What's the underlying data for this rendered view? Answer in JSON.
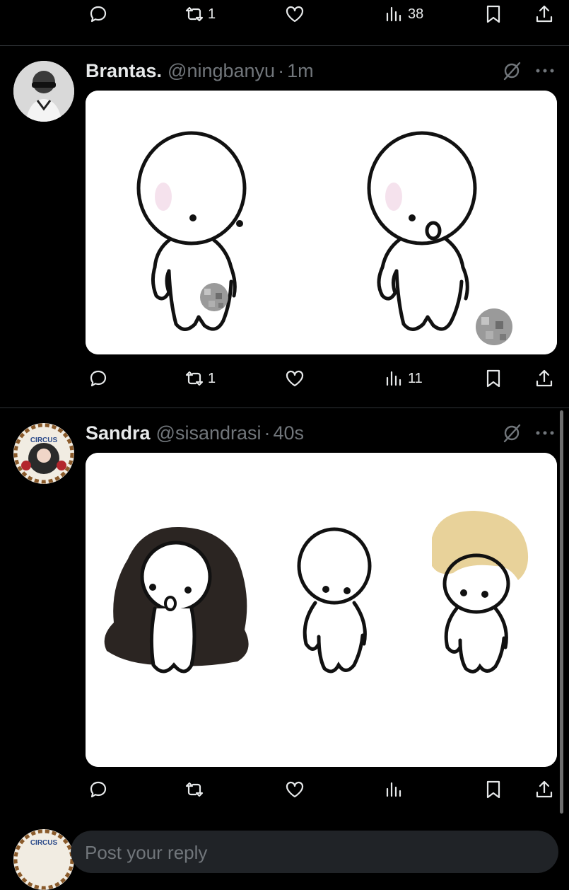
{
  "top_actions": {
    "retweets": "1",
    "views": "38"
  },
  "posts": [
    {
      "name": "Brantas.",
      "handle": "@ningbanyu",
      "sep": "·",
      "time": "1m",
      "stats": {
        "replies": "",
        "retweets": "1",
        "likes": "",
        "views": "11"
      }
    },
    {
      "name": "Sandra",
      "handle": "@sisandrasi",
      "sep": "·",
      "time": "40s",
      "avatar_text": "CIRCUS",
      "stats": {
        "replies": "",
        "retweets": "",
        "likes": "",
        "views": ""
      }
    }
  ],
  "composer": {
    "placeholder": "Post your reply",
    "avatar_text": "CIRCUS"
  },
  "colors": {
    "background": "#000000",
    "text": "#e7e9ea",
    "muted": "#71767b",
    "divider": "#2f3336"
  }
}
